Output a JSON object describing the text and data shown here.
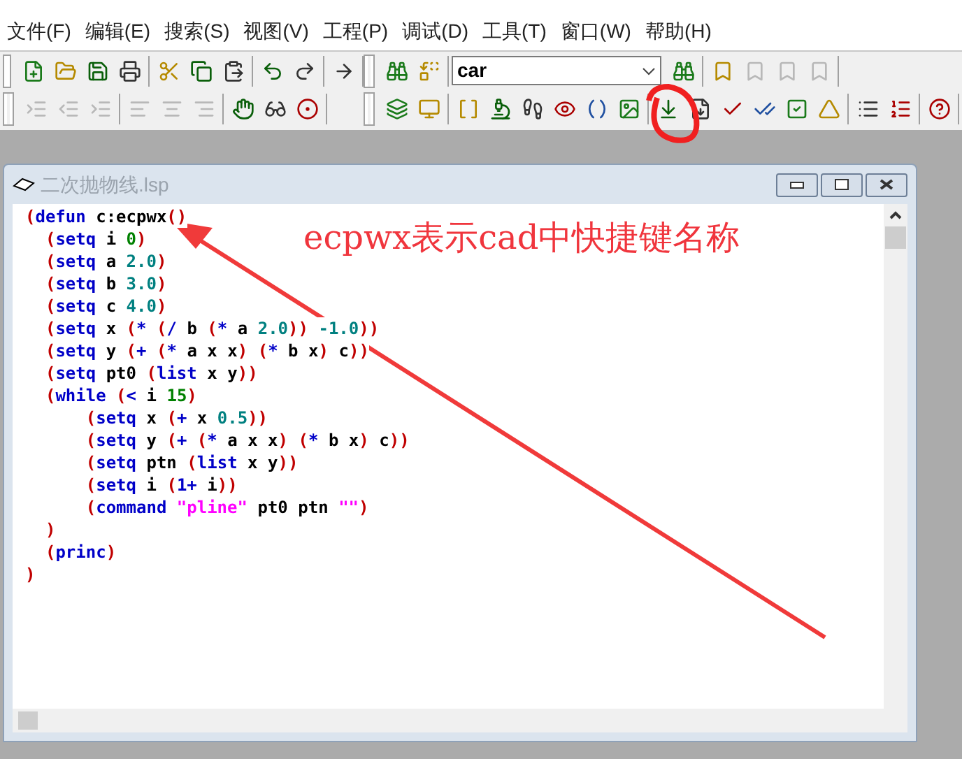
{
  "menu": [
    "文件(F)",
    "编辑(E)",
    "搜索(S)",
    "视图(V)",
    "工程(P)",
    "调试(D)",
    "工具(T)",
    "窗口(W)",
    "帮助(H)"
  ],
  "toolbar_rows": [
    {
      "left": [
        [
          {
            "disabled": false
          },
          {
            "disabled": false
          },
          {
            "disabled": false
          },
          {
            "disabled": false
          }
        ],
        [
          {
            "disabled": false
          },
          {
            "disabled": false
          },
          {
            "disabled": false
          }
        ],
        [
          {
            "disabled": false
          },
          {
            "disabled": false
          }
        ],
        [
          {
            "disabled": false
          }
        ]
      ],
      "right": [
        [
          {
            "disabled": false
          },
          {
            "disabled": false
          }
        ],
        [
          {
            "disabled": false
          }
        ],
        [
          {
            "disabled": false
          },
          {
            "disabled": true
          },
          {
            "disabled": true
          },
          {
            "disabled": true
          }
        ]
      ],
      "search": {
        "value": "car"
      }
    },
    {
      "left": [
        [
          {
            "disabled": true
          },
          {
            "disabled": true
          },
          {
            "disabled": true
          }
        ],
        [
          {
            "disabled": true
          },
          {
            "disabled": true
          },
          {
            "disabled": true
          }
        ],
        [
          {
            "disabled": false
          },
          {
            "disabled": false
          },
          {
            "disabled": false
          }
        ]
      ],
      "right": [
        [
          {
            "disabled": false
          },
          {
            "disabled": false
          }
        ],
        [
          {
            "disabled": false
          },
          {
            "disabled": false
          },
          {
            "disabled": false
          },
          {
            "disabled": false
          },
          {
            "disabled": false
          },
          {
            "disabled": false
          }
        ],
        [
          {
            "disabled": false
          },
          {
            "disabled": false
          },
          {
            "disabled": false
          },
          {
            "disabled": false
          },
          {
            "disabled": false
          },
          {
            "disabled": false
          }
        ],
        [
          {
            "disabled": false
          },
          {
            "disabled": false
          }
        ],
        [
          {
            "disabled": false
          }
        ]
      ]
    }
  ],
  "editor": {
    "title": "二次抛物线.lsp",
    "lines": [
      "(defun c:ecpwx()",
      "  (setq i 0)",
      "  (setq a 2.0)",
      "  (setq b 3.0)",
      "  (setq c 4.0)",
      "  (setq x (* (/ b (* a 2.0)) -1.0))",
      "  (setq y (+ (* a x x) (* b x) c))",
      "  (setq pt0 (list x y))",
      "  (while (< i 15)",
      "      (setq x (+ x 0.5))",
      "      (setq y (+ (* a x x) (* b x) c))",
      "      (setq ptn (list x y))",
      "      (setq i (1+ i))",
      "      (command \"pline\" pt0 ptn \"\")",
      "  )",
      "  (princ)",
      ")"
    ]
  },
  "annotation": {
    "text": "ecpwx表示cad中快捷键名称"
  }
}
